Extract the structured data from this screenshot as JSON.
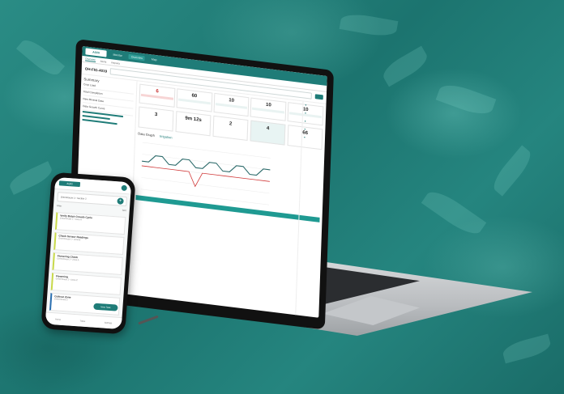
{
  "laptop": {
    "nav": {
      "logo": "AGRI",
      "items": [
        "Monitor",
        "Overview",
        "Map"
      ],
      "active_index": 1
    },
    "subnav": [
      "Overview",
      "Alerts",
      "Reports"
    ],
    "crumb": {
      "title": "OH-FIG-4019"
    },
    "sidebar": {
      "heading": "Summary",
      "rows": [
        "Crop Load",
        "Total Completion",
        "New Mineral Data",
        "Data Growth Curve"
      ]
    },
    "kpis": [
      {
        "value": "6",
        "alert": true
      },
      {
        "value": "60",
        "alert": false
      },
      {
        "value": "10",
        "alert": false
      },
      {
        "value": "10",
        "alert": false
      },
      {
        "value": "10",
        "alert": false
      }
    ],
    "kpis2": [
      {
        "value": "3"
      },
      {
        "value": "9m 12s"
      },
      {
        "value": "2"
      },
      {
        "value": "4"
      },
      {
        "value": "66"
      }
    ],
    "graph": {
      "title": "Data Graph",
      "tab": "Irrigation"
    },
    "chart_data": {
      "type": "line",
      "series": [
        {
          "values": [
            0.6,
            0.6,
            0.75,
            0.75,
            0.6,
            0.6,
            0.75,
            0.75,
            0.6,
            0.6,
            0.75,
            0.75,
            0.6,
            0.6,
            0.75,
            0.75,
            0.6,
            0.6,
            0.75,
            0.75
          ]
        },
        {
          "values": [
            0.5,
            0.5,
            0.5,
            0.5,
            0.5,
            0.5,
            0.5,
            0.5,
            0.2,
            0.5,
            0.5,
            0.5,
            0.5,
            0.5,
            0.5,
            0.5,
            0.5,
            0.5,
            0.5,
            0.5
          ]
        }
      ],
      "colors": [
        "#2b6a6a",
        "#d23b3b"
      ]
    }
  },
  "phone": {
    "logo": "AGRI",
    "crumb": "Greenhouse 1 • Section 2",
    "filter_left": "Filter",
    "filter_right": "Sort",
    "cards": [
      {
        "title": "Verify Batch Growth Cycle",
        "sub": "Greenhouse 1 • Zone A",
        "color": "#c8d94a"
      },
      {
        "title": "Check Sensor Readings",
        "sub": "Greenhouse 1 • Zone B",
        "color": "#c8d94a"
      },
      {
        "title": "Flowering Check",
        "sub": "Greenhouse 2 • Zone A",
        "color": "#c8d94a"
      },
      {
        "title": "Flowering",
        "sub": "Greenhouse 2 • Zone C",
        "color": "#c8d94a"
      },
      {
        "title": "Cultivar Zone",
        "sub": "Greenhouse 3",
        "color": "#2a6fb0"
      }
    ],
    "fab_label": "New Task",
    "bottom": [
      "Home",
      "Tasks",
      "Settings"
    ]
  },
  "colors": {
    "brand": "#1f7c78",
    "alert": "#c62828"
  }
}
